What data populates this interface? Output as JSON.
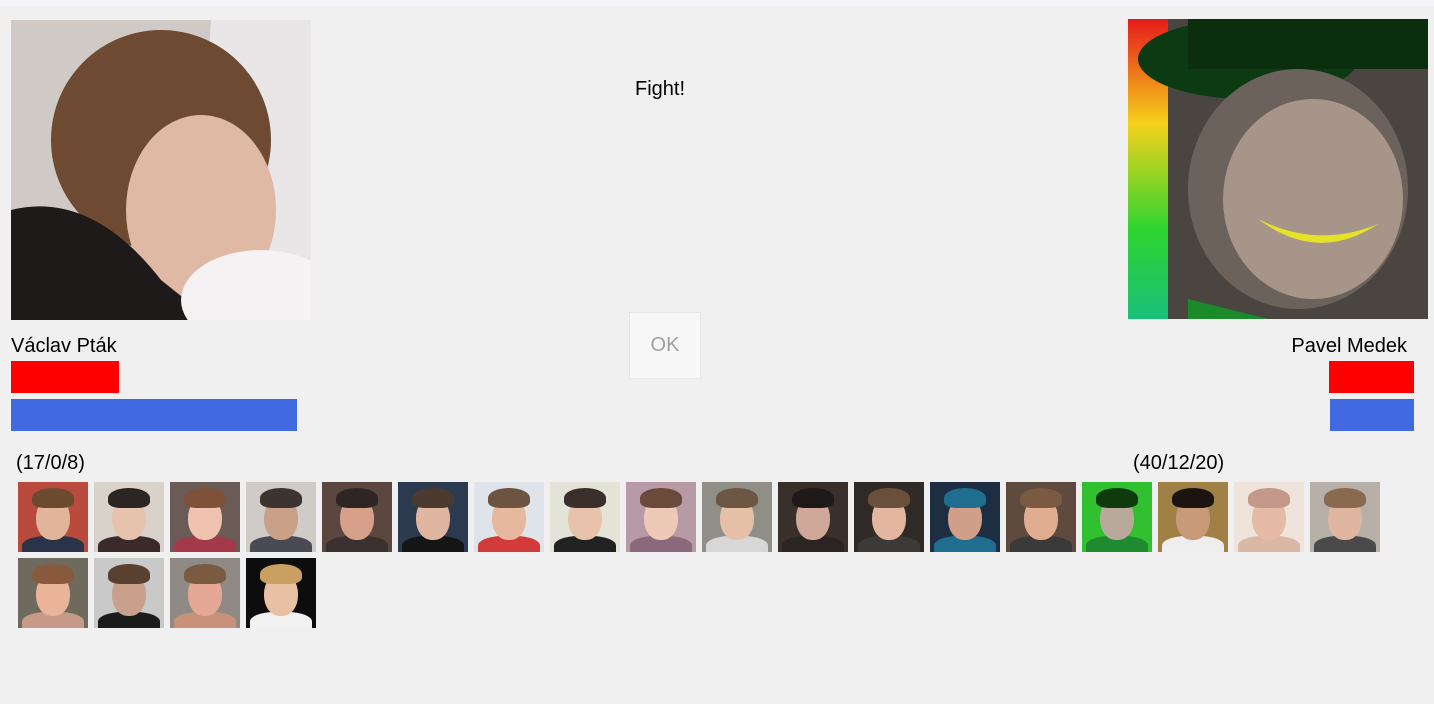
{
  "status_text": "Fight!",
  "ok_button_label": "OK",
  "player1": {
    "name": "Václav Pták",
    "score": "(17/0/8)",
    "health_fraction": 0.38,
    "mana_fraction": 1.0
  },
  "player2": {
    "name": "Pavel Medek",
    "score": "(40/12/20)",
    "health_fraction": 0.3,
    "mana_fraction": 0.29
  },
  "colors": {
    "health_bar": "#ff0000",
    "mana_bar": "#4169e1",
    "background": "#f0f0f0"
  },
  "roster": [
    {
      "bg": "#b94a3e",
      "skin": "#e2b49a",
      "hair": "#6b4a2f",
      "shirt": "#2a3347"
    },
    {
      "bg": "#d9d2cb",
      "skin": "#e7c3ad",
      "hair": "#2b2523",
      "shirt": "#3b2a2a"
    },
    {
      "bg": "#6b5b57",
      "skin": "#f0c3b0",
      "hair": "#7d5238",
      "shirt": "#a33a4a"
    },
    {
      "bg": "#cfcbc6",
      "skin": "#c9a088",
      "hair": "#3b3431",
      "shirt": "#4a4a55"
    },
    {
      "bg": "#5c4740",
      "skin": "#d7a08a",
      "hair": "#2e2524",
      "shirt": "#3a3030"
    },
    {
      "bg": "#2c3a4f",
      "skin": "#e0b6a0",
      "hair": "#4a3a30",
      "shirt": "#151515"
    },
    {
      "bg": "#dfe4ea",
      "skin": "#e6b99f",
      "hair": "#6d5440",
      "shirt": "#d33b3b"
    },
    {
      "bg": "#e3e3d8",
      "skin": "#e8c2aa",
      "hair": "#3a2f2a",
      "shirt": "#222222"
    },
    {
      "bg": "#b89aa6",
      "skin": "#efc9b8",
      "hair": "#6a4a3a",
      "shirt": "#8a6a7a"
    },
    {
      "bg": "#8f8f88",
      "skin": "#e5c0a6",
      "hair": "#6d5744",
      "shirt": "#d7d7d7"
    },
    {
      "bg": "#3a302b",
      "skin": "#cfa89a",
      "hair": "#1d1a19",
      "shirt": "#2a2422"
    },
    {
      "bg": "#2f2a26",
      "skin": "#e3b79f",
      "hair": "#6a4f3a",
      "shirt": "#3b3a38"
    },
    {
      "bg": "#1d2d42",
      "skin": "#cf9f88",
      "hair": "#1f6d8f",
      "shirt": "#1f6d8f"
    },
    {
      "bg": "#5f4a3e",
      "skin": "#e0ad90",
      "hair": "#7a5a40",
      "shirt": "#3a3a3a"
    },
    {
      "bg": "#30c030",
      "skin": "#b9a99b",
      "hair": "#0e3a0e",
      "shirt": "#1f8a2f"
    },
    {
      "bg": "#a08044",
      "skin": "#c99a78",
      "hair": "#1c1410",
      "shirt": "#eeeeee"
    },
    {
      "bg": "#efe4dc",
      "skin": "#e6bba6",
      "hair": "#c4998a",
      "shirt": "#d9b9a5"
    },
    {
      "bg": "#b7b0a8",
      "skin": "#e0b6a0",
      "hair": "#8a6a4e",
      "shirt": "#4a4a4a"
    },
    {
      "bg": "#6e6a5e",
      "skin": "#eab49b",
      "hair": "#8a5a3c",
      "shirt": "#c69a86"
    },
    {
      "bg": "#c9c9c9",
      "skin": "#c8a08c",
      "hair": "#5a4030",
      "shirt": "#1b1b1b"
    },
    {
      "bg": "#8f8a86",
      "skin": "#e6a896",
      "hair": "#7a5a40",
      "shirt": "#c9907a"
    },
    {
      "bg": "#0d0d0d",
      "skin": "#e8c0a4",
      "hair": "#c9a062",
      "shirt": "#f2f2f2"
    }
  ]
}
